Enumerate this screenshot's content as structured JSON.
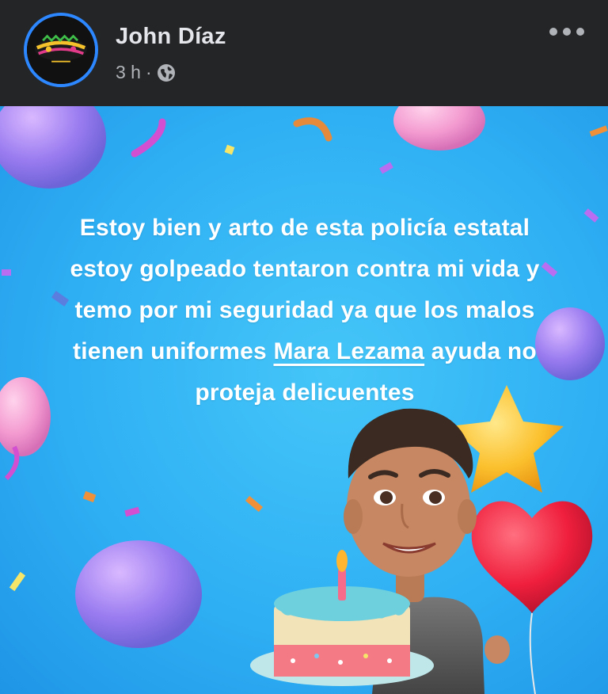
{
  "post": {
    "author": "John Díaz",
    "time": "3 h",
    "separator": "·",
    "privacy_icon": "globe-icon",
    "more_icon": "more-options-icon",
    "avatar_icon": "page-logo-avatar",
    "text_before": "Estoy bien y arto de esta policía estatal estoy golpeado tentaron contra mi vida y temo por mi seguridad ya que los malos tienen uniformes ",
    "mention": "Mara Lezama",
    "text_after": " ayuda no proteja delicuentes",
    "background_color": "#2fb0f4",
    "text_color": "#ffffff"
  },
  "colors": {
    "header_bg": "#242526",
    "primary_text": "#e4e6eb",
    "secondary_text": "#b0b3b8",
    "avatar_ring": "#2d88ff"
  }
}
